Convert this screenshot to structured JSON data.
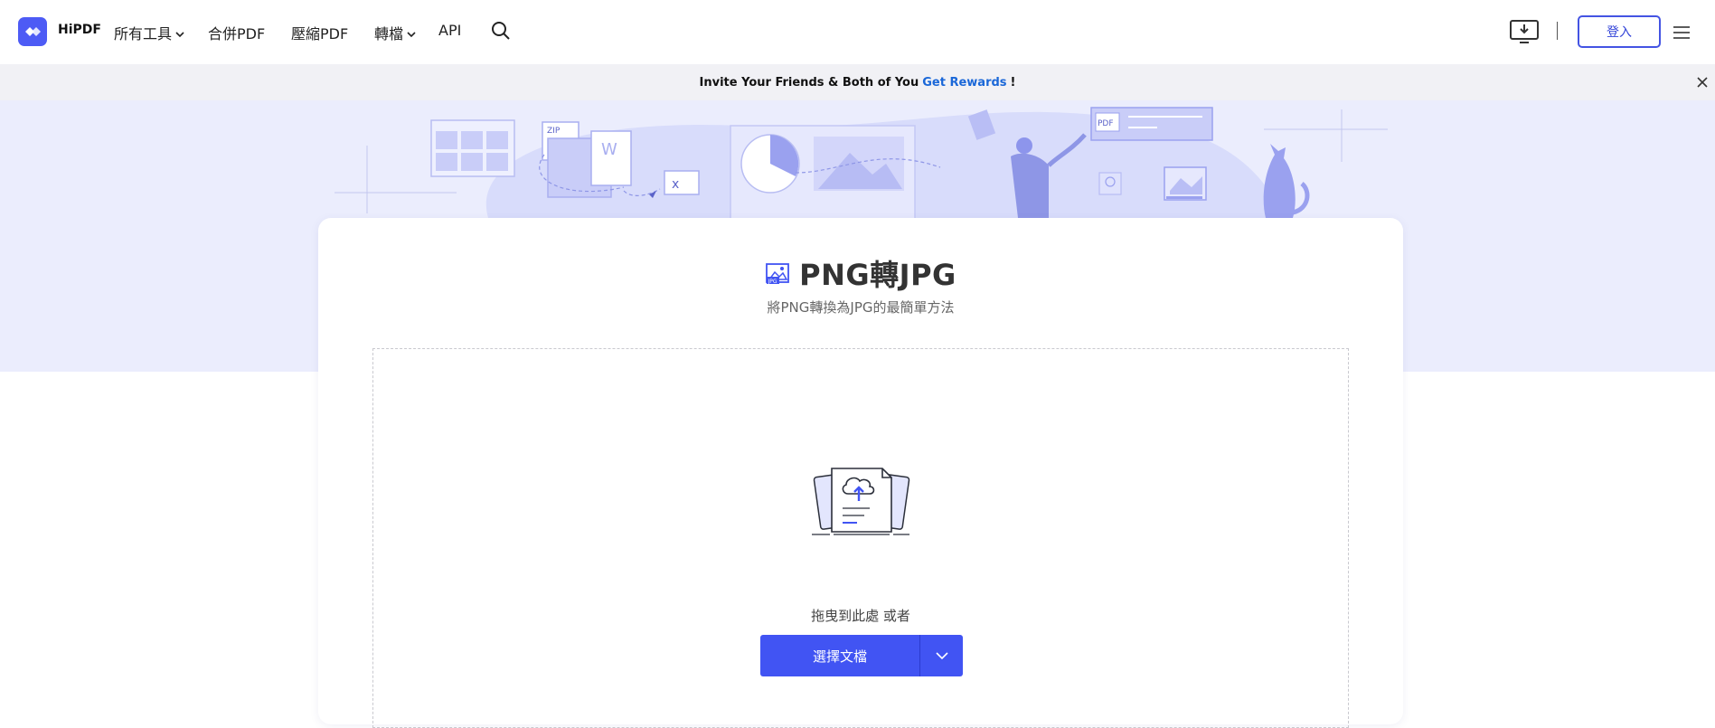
{
  "header": {
    "logo_text": "HiPDF",
    "nav": {
      "all_tools": "所有工具",
      "merge_pdf": "合併PDF",
      "compress_pdf": "壓縮PDF",
      "convert": "轉檔",
      "api": "API"
    },
    "login_label": "登入"
  },
  "banner": {
    "text": "Invite Your Friends & Both of You",
    "link": "Get Rewards",
    "suffix": "!"
  },
  "main": {
    "title": "PNG轉JPG",
    "subtitle": "將PNG轉換為JPG的最簡單方法",
    "drag_text": "拖曳到此處 或者",
    "choose_file_label": "選擇文檔"
  },
  "colors": {
    "brand": "#4d5bf5",
    "primary_button": "#4154f3",
    "link": "#1a67d8",
    "hero_bg": "#ebedfd"
  },
  "icons": {
    "logo": "hipdf-logo-icon",
    "search": "search-icon",
    "download": "download-icon",
    "menu": "hamburger-menu-icon",
    "close": "close-icon",
    "title": "image-jpg-icon",
    "upload": "cloud-upload-icon",
    "dropdown": "chevron-down-icon"
  }
}
